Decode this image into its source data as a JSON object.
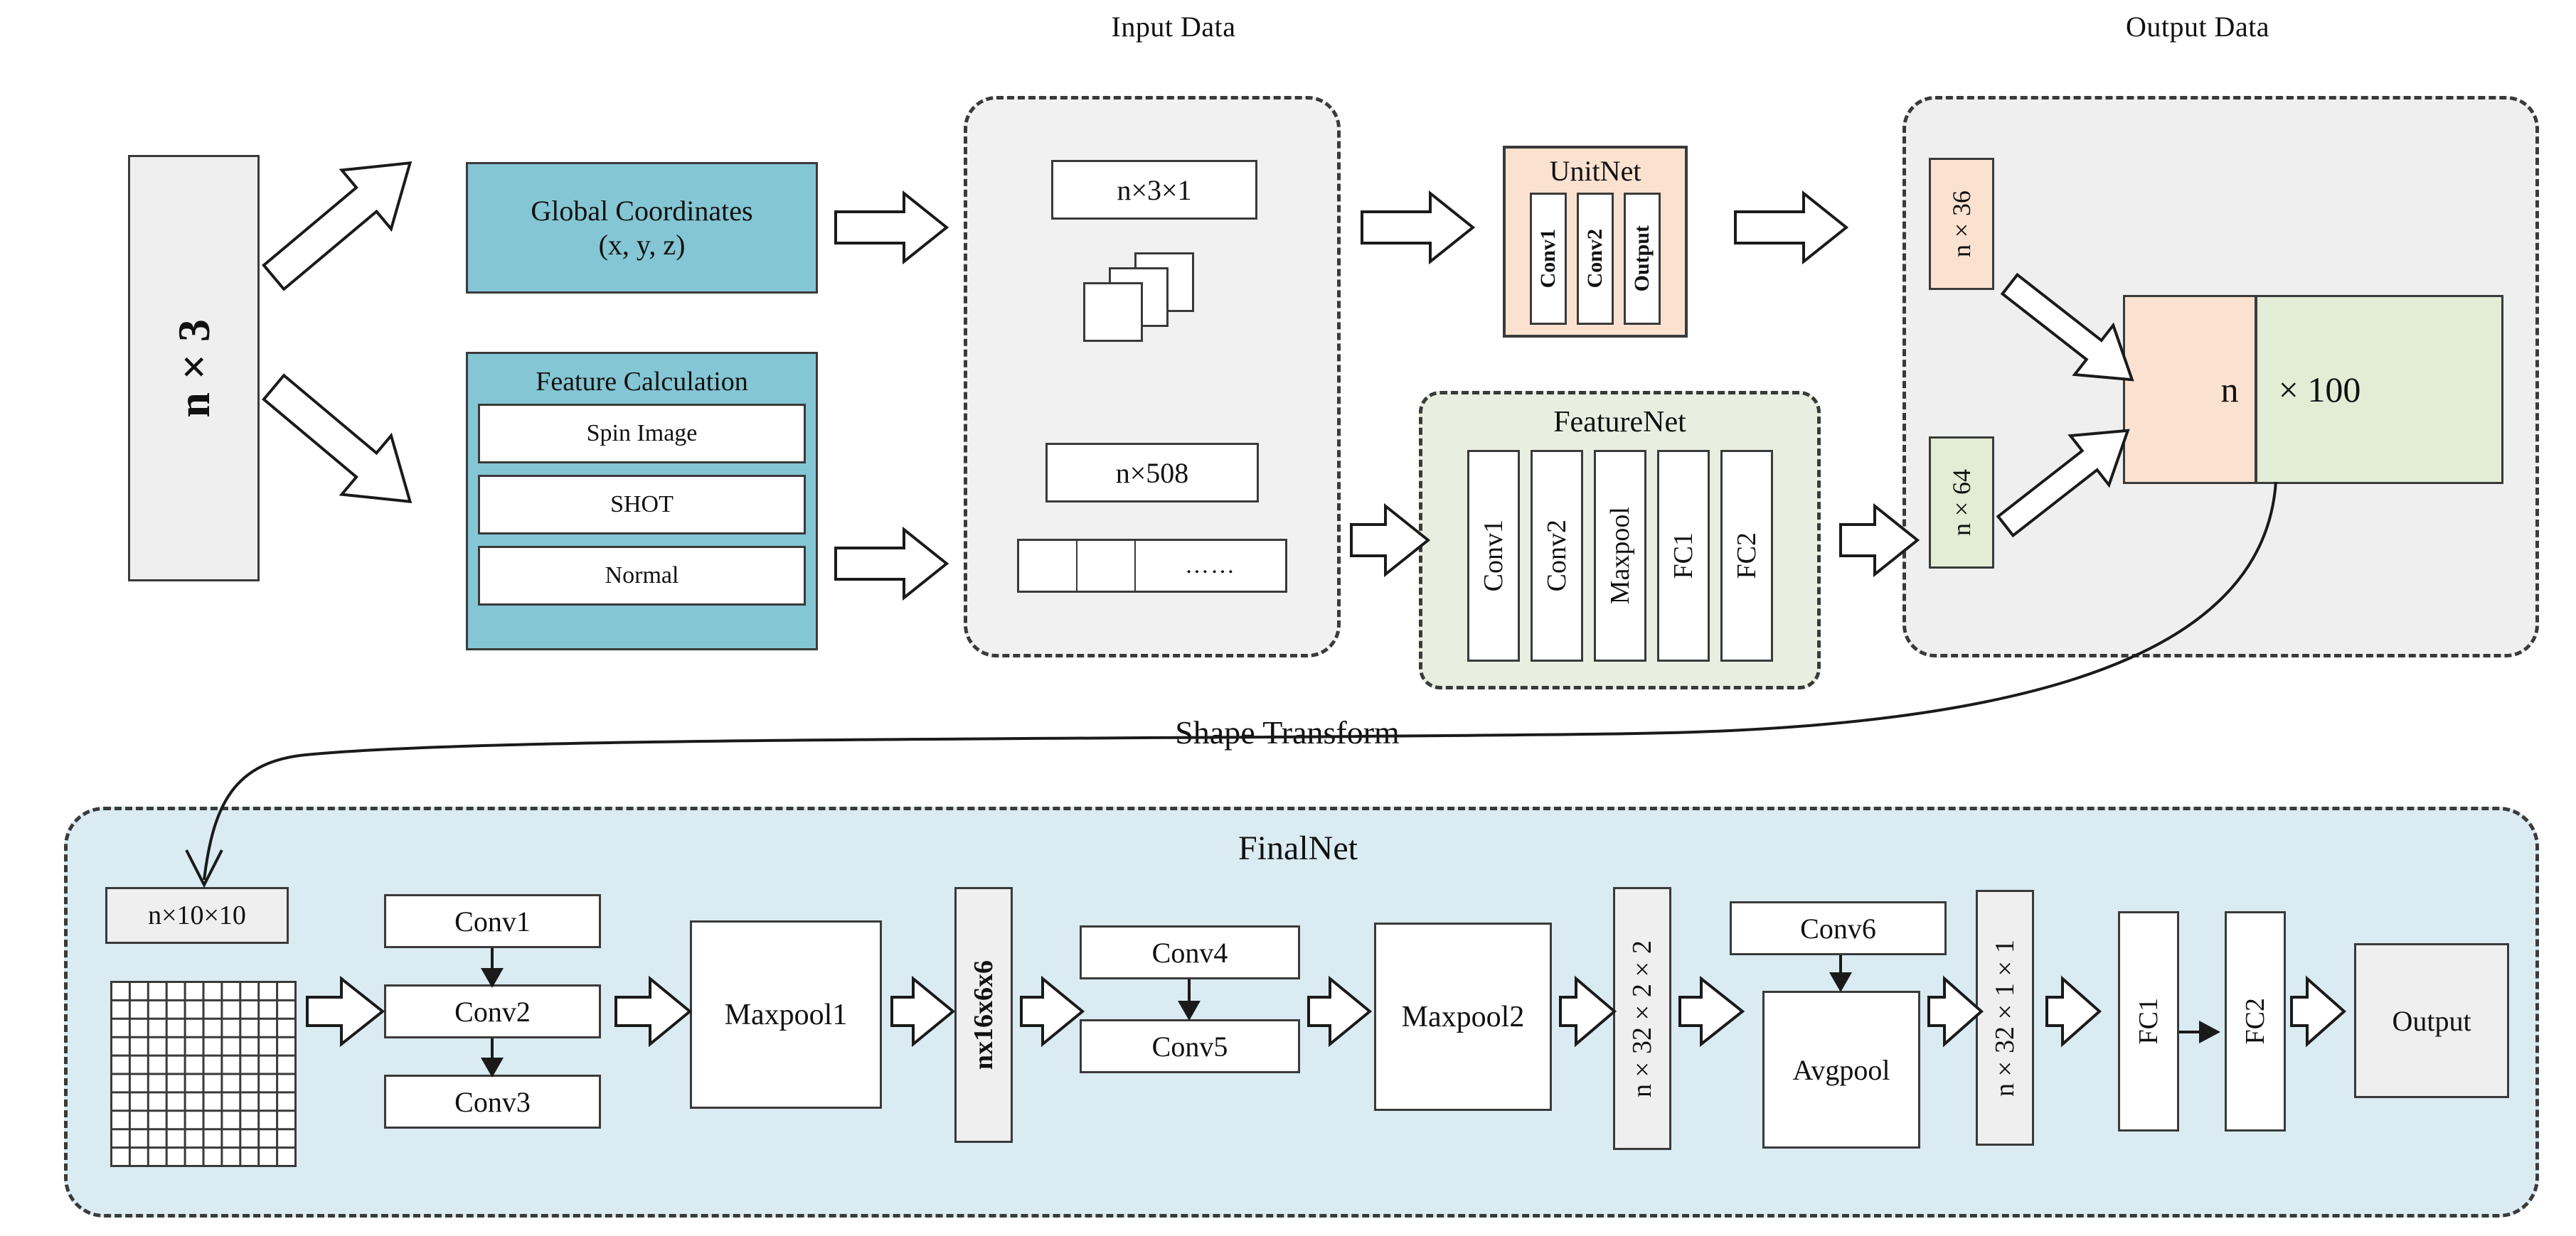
{
  "diagram": {
    "title_input": "Input Data",
    "title_output": "Output Data",
    "shape_transform_label": "Shape Transform"
  },
  "source": {
    "label": "n×3"
  },
  "branches": {
    "global_coordinates": {
      "title": "Global Coordinates",
      "subtitle": "(x, y, z)"
    },
    "feature_calculation": {
      "title": "Feature Calculation",
      "items": [
        "Spin Image",
        "SHOT",
        "Normal"
      ]
    }
  },
  "input_data": {
    "tensor_top": "n×3×1",
    "tensor_bottom": "n×508",
    "stack_icon": "stacked-planes-icon",
    "cells_ellipsis": "……"
  },
  "unitnet": {
    "title": "UnitNet",
    "layers": [
      "Conv1",
      "Conv2",
      "Output"
    ]
  },
  "featurenet": {
    "title": "FeatureNet",
    "layers": [
      "Conv1",
      "Conv2",
      "Maxpool",
      "FC1",
      "FC2"
    ]
  },
  "output_data": {
    "tensor_peach": "n×36",
    "tensor_green": "n×64",
    "combined_left": "n",
    "combined_right": "× 100"
  },
  "finalnet": {
    "title": "FinalNet",
    "input_tensor": "n×10×10",
    "grid_icon": "grid-10x10-icon",
    "conv_block_1": [
      "Conv1",
      "Conv2",
      "Conv3"
    ],
    "maxpool1": "Maxpool1",
    "tensor_16x6x6": "nx16x6x6",
    "conv_block_2": [
      "Conv4",
      "Conv5"
    ],
    "maxpool2": "Maxpool2",
    "tensor_32x2x2": "n×32×2×2",
    "conv6": "Conv6",
    "avgpool": "Avgpool",
    "tensor_32x1x1": "n×32×1×1",
    "fc1": "FC1",
    "fc2": "FC2",
    "output": "Output"
  },
  "colors": {
    "teal": "#84c6d4",
    "peach": "#fbe2d0",
    "green": "#e3edd6",
    "final_blue": "#daebf2",
    "panel_grey": "#efefef",
    "stroke": "#3a3a3a"
  }
}
